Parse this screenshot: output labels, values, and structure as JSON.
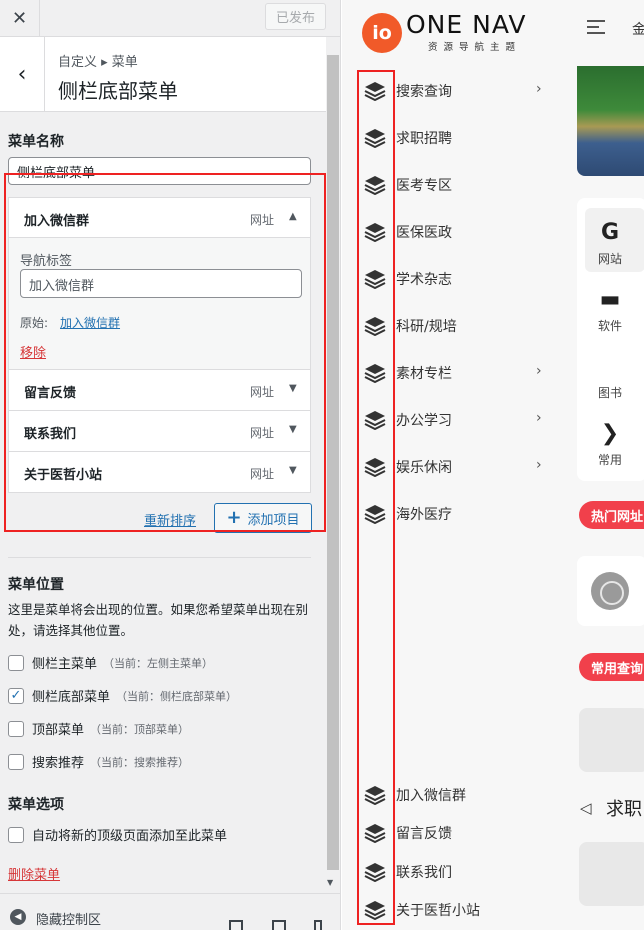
{
  "topbar": {
    "close_glyph": "✕",
    "publish_label": "已发布"
  },
  "section": {
    "back_glyph": "‹",
    "breadcrumb": "自定义 ▸ 菜单",
    "title": "侧栏底部菜单"
  },
  "menu_name": {
    "label": "菜单名称",
    "value": "侧栏底部菜单"
  },
  "menu_items": [
    {
      "title": "加入微信群",
      "type": "网址",
      "arrow": "▲",
      "expanded": true
    },
    {
      "title": "留言反馈",
      "type": "网址",
      "arrow": "▼"
    },
    {
      "title": "联系我们",
      "type": "网址",
      "arrow": "▼"
    },
    {
      "title": "关于医哲小站",
      "type": "网址",
      "arrow": "▼"
    }
  ],
  "item_detail": {
    "nav_label_title": "导航标签",
    "nav_label_value": "加入微信群",
    "original_label": "原始:",
    "original_link": "加入微信群",
    "remove_label": "移除"
  },
  "actions": {
    "reorder_label": "重新排序",
    "add_plus": "+",
    "add_label": "添加项目"
  },
  "menu_location": {
    "heading": "菜单位置",
    "description": "这里是菜单将会出现的位置。如果您希望菜单出现在别处，请选择其他位置。",
    "options": [
      {
        "label": "侧栏主菜单",
        "current": "（当前：左侧主菜单）",
        "checked": false,
        "mark": ""
      },
      {
        "label": "侧栏底部菜单",
        "current": "（当前：侧栏底部菜单）",
        "checked": true,
        "mark": "✓"
      },
      {
        "label": "顶部菜单",
        "current": "（当前：顶部菜单）",
        "checked": false,
        "mark": ""
      },
      {
        "label": "搜索推荐",
        "current": "（当前：搜索推荐）",
        "checked": false,
        "mark": ""
      }
    ]
  },
  "menu_options": {
    "heading": "菜单选项",
    "auto_add_label": "自动将新的顶级页面添加至此菜单"
  },
  "delete_menu_label": "删除菜单",
  "footer": {
    "collapse_glyph": "◀",
    "collapse_label": "隐藏控制区",
    "scroll_glyph": "▼"
  },
  "preview": {
    "logo_badge": "io",
    "logo_text": "ONE NAV",
    "logo_sub": "资源导航主题",
    "top_nav_partial": "金",
    "sidebar_items": [
      {
        "label": "搜索查询",
        "chevron": "›"
      },
      {
        "label": "求职招聘",
        "chevron": ""
      },
      {
        "label": "医考专区",
        "chevron": ""
      },
      {
        "label": "医保医政",
        "chevron": ""
      },
      {
        "label": "学术杂志",
        "chevron": ""
      },
      {
        "label": "科研/规培",
        "chevron": ""
      },
      {
        "label": "素材专栏",
        "chevron": "›"
      },
      {
        "label": "办公学习",
        "chevron": "›"
      },
      {
        "label": "娱乐休闲",
        "chevron": "›"
      },
      {
        "label": "海外医疗",
        "chevron": ""
      }
    ],
    "bottom_items": [
      "加入微信群",
      "留言反馈",
      "联系我们",
      "关于医哲小站"
    ],
    "tabs": [
      {
        "glyph": "G",
        "label": "网站"
      },
      {
        "glyph": "▬",
        "label": "软件"
      },
      {
        "glyph": "",
        "label": "图书"
      },
      {
        "glyph": "❯",
        "label": "常用"
      }
    ],
    "pill_hot": "热门网址",
    "pill_common": "常用查询",
    "tag_glyph": "◁",
    "section_partial": "求职"
  }
}
